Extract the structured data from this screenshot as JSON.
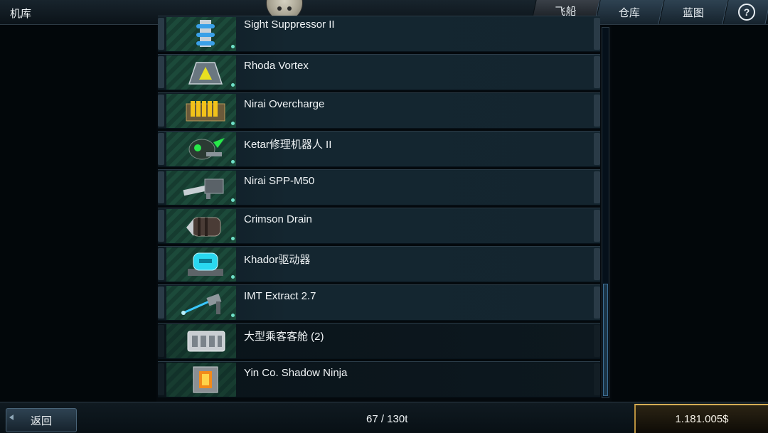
{
  "header": {
    "title": "机库",
    "tabs": [
      {
        "label": "飞船",
        "active": true
      },
      {
        "label": "仓库",
        "active": false
      },
      {
        "label": "蓝图",
        "active": false
      }
    ],
    "help_icon": "question-icon"
  },
  "items": [
    {
      "name": "Sight Suppressor II",
      "icon": "sight-suppressor-icon"
    },
    {
      "name": "Rhoda Vortex",
      "icon": "rhoda-vortex-icon"
    },
    {
      "name": "Nirai Overcharge",
      "icon": "nirai-overcharge-icon"
    },
    {
      "name": "Ketar修理机器人 II",
      "icon": "repair-bot-icon"
    },
    {
      "name": "Nirai SPP-M50",
      "icon": "cannon-icon"
    },
    {
      "name": "Crimson Drain",
      "icon": "crimson-drain-icon"
    },
    {
      "name": "Khador驱动器",
      "icon": "drive-icon"
    },
    {
      "name": "IMT Extract 2.7",
      "icon": "extractor-icon"
    },
    {
      "name": "大型乘客客舱 (2)",
      "icon": "passenger-cabin-icon"
    },
    {
      "name": "Yin Co. Shadow Ninja",
      "icon": "shadow-ninja-icon"
    }
  ],
  "footer": {
    "back_label": "返回",
    "capacity": "67 / 130t",
    "credits": "1.181.005$"
  },
  "colors": {
    "accent_gold": "#c9a24a",
    "status_dot": "#6fe0c8",
    "scroll_thumb": "#3b6e94"
  }
}
